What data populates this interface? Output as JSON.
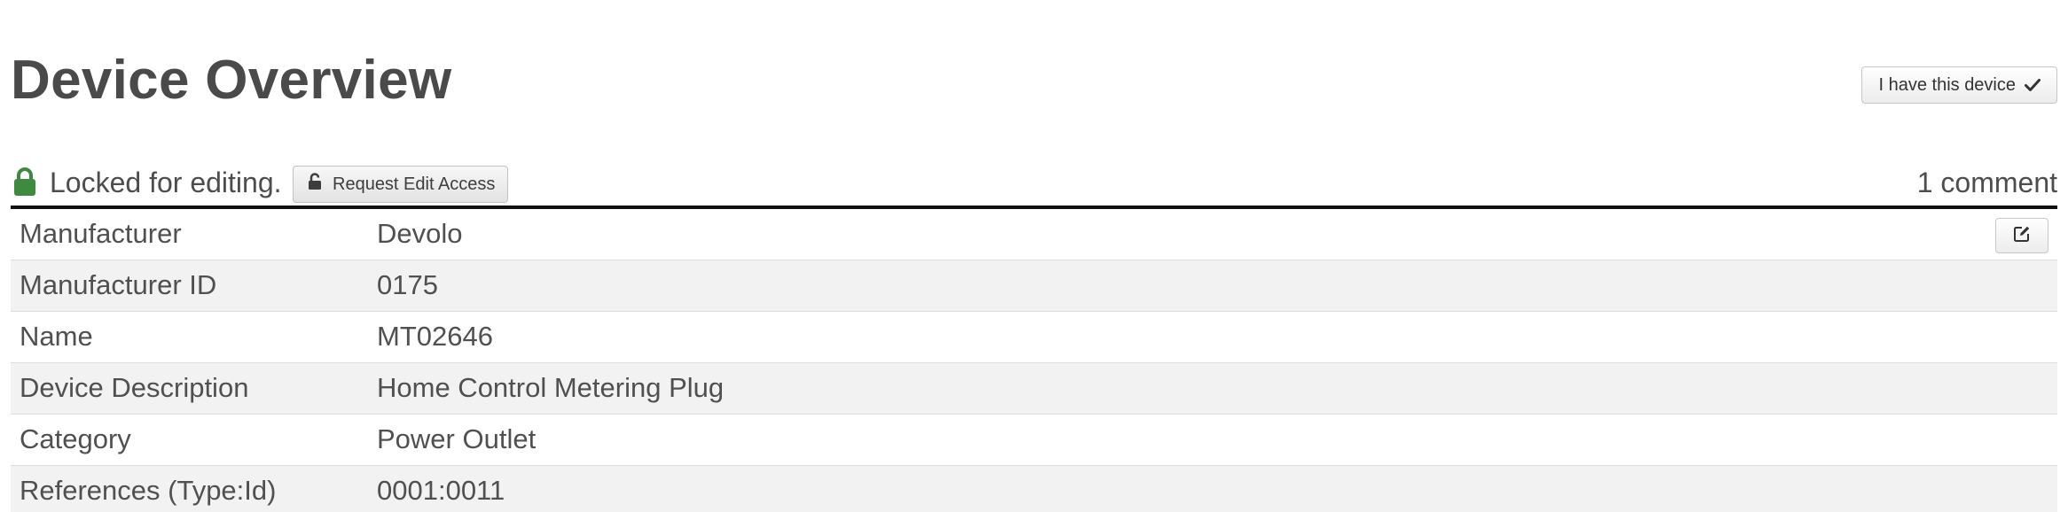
{
  "header": {
    "title": "Device Overview",
    "have_device_label": "I have this device"
  },
  "lock_bar": {
    "status_text": "Locked for editing.",
    "request_button_label": "Request Edit Access",
    "comments_label": "1 comment"
  },
  "colors": {
    "lock_green": "#3e8a3e",
    "text": "#505050",
    "row_alt_bg": "#f2f2f2"
  },
  "icons": {
    "have_device": "check-icon",
    "lock_status": "lock-icon",
    "request_access": "unlock-icon",
    "edit_row": "edit-icon"
  },
  "details": {
    "rows": [
      {
        "label": "Manufacturer",
        "value": "Devolo"
      },
      {
        "label": "Manufacturer ID",
        "value": "0175"
      },
      {
        "label": "Name",
        "value": "MT02646"
      },
      {
        "label": "Device Description",
        "value": "Home Control Metering Plug"
      },
      {
        "label": "Category",
        "value": "Power Outlet"
      },
      {
        "label": "References (Type:Id)",
        "value": "0001:0011"
      }
    ]
  }
}
